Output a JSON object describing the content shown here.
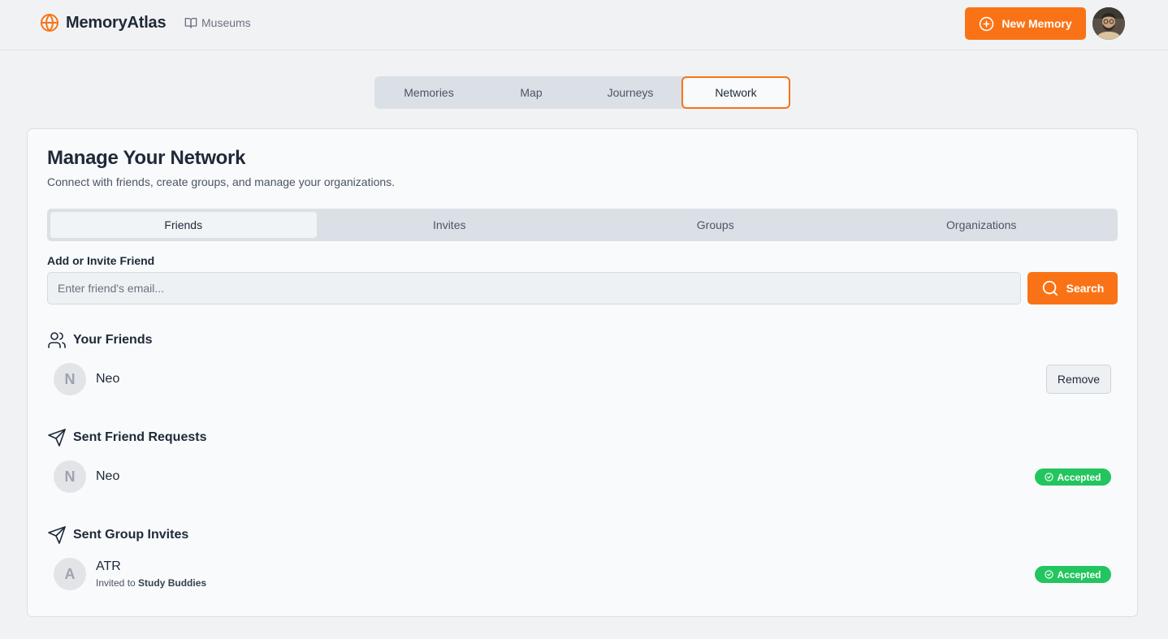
{
  "header": {
    "brand_name": "MemoryAtlas",
    "museums_label": "Museums",
    "new_memory_label": "New Memory"
  },
  "main_tabs": [
    {
      "label": "Memories",
      "active": false
    },
    {
      "label": "Map",
      "active": false
    },
    {
      "label": "Journeys",
      "active": false
    },
    {
      "label": "Network",
      "active": true
    }
  ],
  "network": {
    "title": "Manage Your Network",
    "subtitle": "Connect with friends, create groups, and manage your organizations.",
    "sub_tabs": [
      {
        "label": "Friends",
        "active": true
      },
      {
        "label": "Invites",
        "active": false
      },
      {
        "label": "Groups",
        "active": false
      },
      {
        "label": "Organizations",
        "active": false
      }
    ],
    "add_label": "Add or Invite Friend",
    "email_placeholder": "Enter friend's email...",
    "search_label": "Search",
    "friends": {
      "heading": "Your Friends",
      "items": [
        {
          "initial": "N",
          "name": "Neo",
          "action_label": "Remove"
        }
      ]
    },
    "sent_requests": {
      "heading": "Sent Friend Requests",
      "items": [
        {
          "initial": "N",
          "name": "Neo",
          "status": "Accepted"
        }
      ]
    },
    "group_invites": {
      "heading": "Sent Group Invites",
      "items": [
        {
          "initial": "A",
          "name": "ATR",
          "invited_prefix": "Invited to",
          "group_name": "Study Buddies",
          "status": "Accepted"
        }
      ]
    }
  },
  "colors": {
    "accent": "#f97316",
    "success": "#22c55e",
    "background": "#f1f2f4",
    "card": "#f8fafc"
  }
}
